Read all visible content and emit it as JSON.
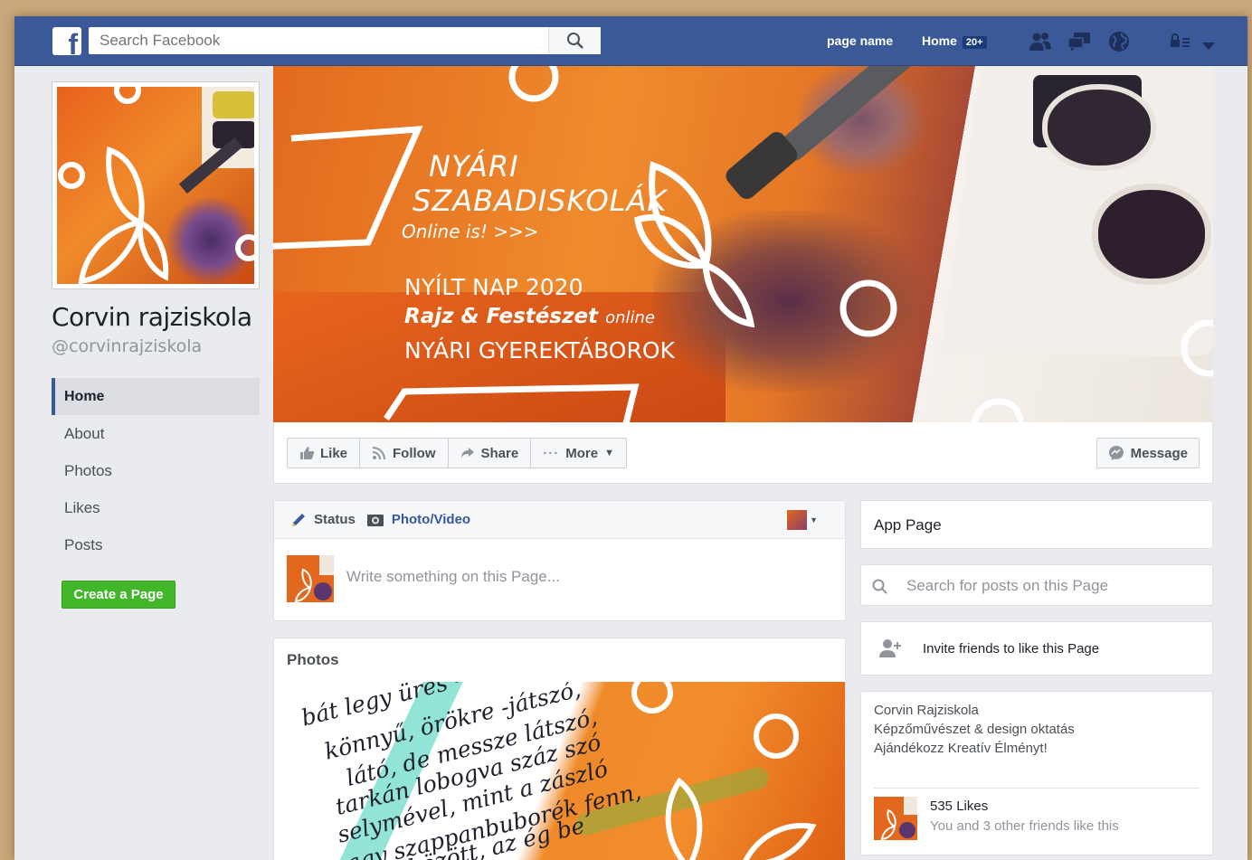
{
  "topbar": {
    "search_placeholder": "Search Facebook",
    "page_name": "page name",
    "home_label": "Home",
    "home_badge": "20+",
    "brand_color": "#3b5998",
    "icons": [
      "friends-icon",
      "messages-icon",
      "globe-icon",
      "privacy-icon",
      "dropdown-icon"
    ]
  },
  "page": {
    "title": "Corvin rajziskola",
    "handle": "@corvinrajziskola"
  },
  "nav": {
    "items": [
      "Home",
      "About",
      "Photos",
      "Likes",
      "Posts"
    ],
    "active": "Home",
    "create_page": "Create a Page"
  },
  "cover": {
    "line1": "NYÁRI",
    "line2": "SZABADISKOLÁK",
    "line3": "Online is! >>>",
    "line4": "NYÍLT NAP 2020",
    "line5a": "Rajz & Festészet",
    "line5b": "online",
    "line6": "NYÁRI GYEREKTÁBOROK"
  },
  "actions": {
    "like": "Like",
    "follow": "Follow",
    "share": "Share",
    "more": "More",
    "message": "Message"
  },
  "composer": {
    "status": "Status",
    "photo_video": "Photo/Video",
    "placeholder": "Write something on this Page..."
  },
  "photos": {
    "heading": "Photos",
    "calligraphy": [
      "bát legy üres -",
      "könnyű, örökre -játszó,",
      "látó, de messze látszó,",
      "tarkán lobogva száz szó",
      "selymével, mint a zászló",
      "vagy szappanbuborék fenn,",
      "lélek között, az ég be"
    ]
  },
  "sidebar": {
    "app_page": "App Page",
    "search_posts": "Search for posts on this Page",
    "invite": "Invite friends to like this Page",
    "about_line1": "Corvin Rajziskola",
    "about_line2": "Képzőművészet & design oktatás",
    "about_line3": "Ajándékozz Kreatív Élményt!",
    "likes_count": "535 Likes",
    "likes_friends": "You and 3 other friends like this"
  }
}
